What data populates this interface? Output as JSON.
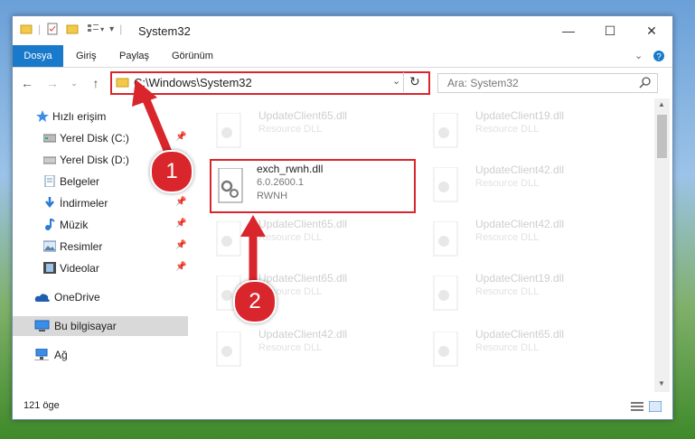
{
  "window": {
    "title": "System32",
    "controls": {
      "minimize": "—",
      "maximize": "☐",
      "close": "✕"
    }
  },
  "ribbon": {
    "tabs": [
      "Dosya",
      "Giriş",
      "Paylaş",
      "Görünüm"
    ]
  },
  "address": {
    "path": "C:\\Windows\\System32",
    "search_placeholder": "Ara: System32"
  },
  "sidebar": {
    "items": [
      {
        "label": "Hızlı erişim",
        "icon": "star-icon",
        "pinned": false
      },
      {
        "label": "Yerel Disk (C:)",
        "icon": "drive-icon",
        "pinned": true
      },
      {
        "label": "Yerel Disk (D:)",
        "icon": "drive-icon",
        "pinned": false
      },
      {
        "label": "Belgeler",
        "icon": "documents-icon",
        "pinned": false
      },
      {
        "label": "İndirmeler",
        "icon": "download-icon",
        "pinned": true
      },
      {
        "label": "Müzik",
        "icon": "music-icon",
        "pinned": true
      },
      {
        "label": "Resimler",
        "icon": "pictures-icon",
        "pinned": true
      },
      {
        "label": "Videolar",
        "icon": "videos-icon",
        "pinned": true
      },
      {
        "label": "OneDrive",
        "icon": "cloud-icon",
        "pinned": false
      },
      {
        "label": "Bu bilgisayar",
        "icon": "computer-icon",
        "pinned": false
      },
      {
        "label": "Ağ",
        "icon": "network-icon",
        "pinned": false
      }
    ]
  },
  "files": {
    "highlighted": {
      "name": "exch_rwnh.dll",
      "version": "6.0.2600.1",
      "desc": "RWNH"
    },
    "ghosts": [
      {
        "name": "UpdateClient65.dll",
        "desc": "Resource DLL"
      },
      {
        "name": "UpdateClient19.dll",
        "desc": "Resource DLL"
      },
      {
        "name": "UpdateClient42.dll",
        "desc": "Resource DLL"
      },
      {
        "name": "UpdateClient65.dll",
        "desc": "Resource DLL"
      },
      {
        "name": "UpdateClient42.dll",
        "desc": "Resource DLL"
      },
      {
        "name": "UpdateClient65.dll",
        "desc": "Resource DLL"
      },
      {
        "name": "UpdateClient19.dll",
        "desc": "Resource DLL"
      },
      {
        "name": "UpdateClient42.dll",
        "desc": "Resource DLL"
      },
      {
        "name": "UpdateClient65.dll",
        "desc": "Resource DLL"
      }
    ]
  },
  "status": {
    "count": "121 öge"
  },
  "callouts": [
    "1",
    "2"
  ],
  "colors": {
    "accent": "#1979ca",
    "highlight": "#d9262c"
  }
}
